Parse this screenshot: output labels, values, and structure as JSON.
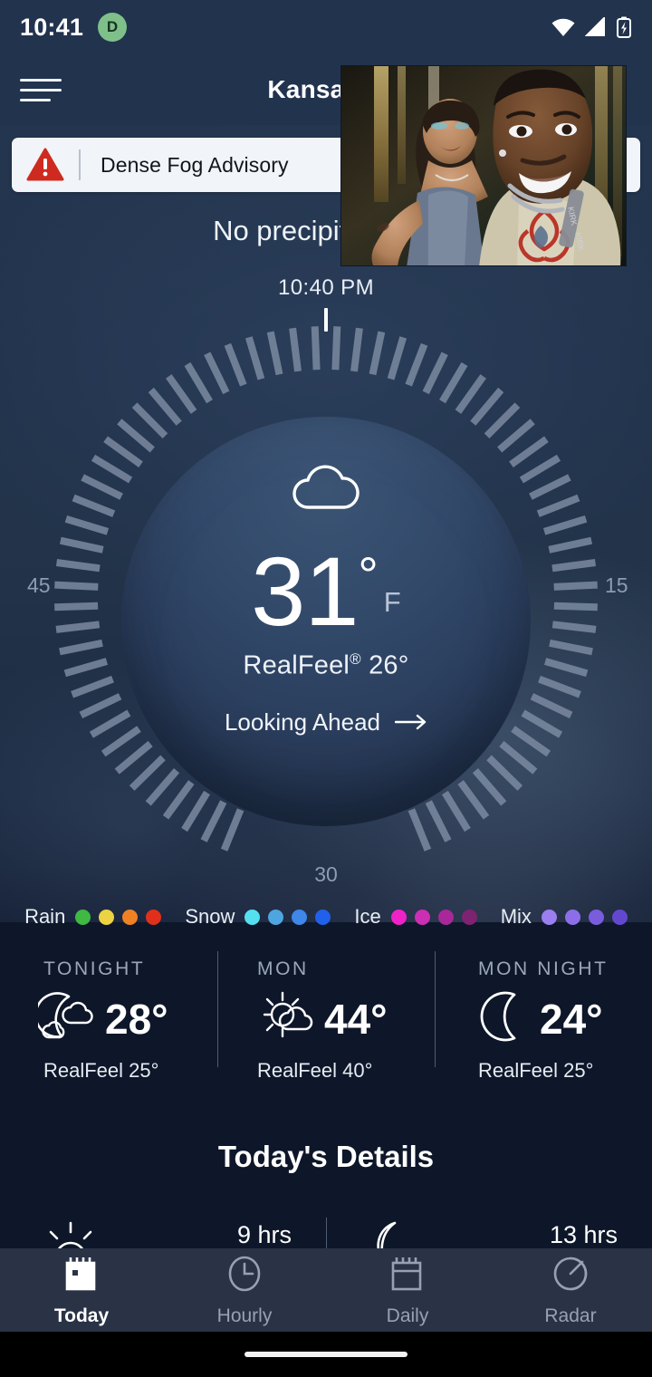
{
  "status_bar": {
    "time": "10:41",
    "badge_letter": "D",
    "icons": [
      "wifi-icon",
      "cellular-signal-icon",
      "battery-charging-icon"
    ]
  },
  "app_bar": {
    "menu_icon": "hamburger-menu-icon",
    "title": "Kansas C"
  },
  "alert": {
    "icon": "warning-triangle-icon",
    "text": "Dense Fog Advisory"
  },
  "precipitation_summary": "No precipitation fo",
  "dial": {
    "time_label": "10:40 PM",
    "label_left": "45",
    "label_right": "15",
    "label_bottom": "30",
    "weather_icon": "cloud-icon",
    "temperature": "31",
    "degree": "°",
    "unit": "F",
    "realfeel_prefix": "RealFeel",
    "realfeel_reg": "®",
    "realfeel_value": "26°",
    "looking_ahead_label": "Looking Ahead",
    "looking_ahead_icon": "arrow-right-icon"
  },
  "precip_legend": [
    {
      "label": "Rain",
      "colors": [
        "#3fb844",
        "#ecd341",
        "#ef8125",
        "#e0301c"
      ]
    },
    {
      "label": "Snow",
      "colors": [
        "#55e0f0",
        "#4fa5e0",
        "#3f87e8",
        "#2060ea"
      ]
    },
    {
      "label": "Ice",
      "colors": [
        "#ef22c8",
        "#cc2eb4",
        "#a8289a",
        "#7d2372"
      ]
    },
    {
      "label": "Mix",
      "colors": [
        "#9b7ff0",
        "#8c6fe8",
        "#7a5ddd",
        "#6348cf"
      ]
    }
  ],
  "forecast": [
    {
      "title": "TONIGHT",
      "icon": "moon-cloud-icon",
      "temp": "28°",
      "realfeel": "RealFeel 25°"
    },
    {
      "title": "MON",
      "icon": "sun-cloud-icon",
      "temp": "44°",
      "realfeel": "RealFeel 40°"
    },
    {
      "title": "MON NIGHT",
      "icon": "moon-icon",
      "temp": "24°",
      "realfeel": "RealFeel 25°"
    }
  ],
  "details": {
    "title": "Today's Details",
    "items": [
      {
        "icon": "sunrise-icon",
        "value": "9 hrs"
      },
      {
        "icon": "moon-phase-icon",
        "value": "13 hrs"
      }
    ]
  },
  "bottom_nav": [
    {
      "label": "Today",
      "icon": "calendar-today-icon",
      "active": true
    },
    {
      "label": "Hourly",
      "icon": "clock-icon",
      "active": false
    },
    {
      "label": "Daily",
      "icon": "calendar-icon",
      "active": false
    },
    {
      "label": "Radar",
      "icon": "radar-icon",
      "active": false
    }
  ],
  "pip_video": {
    "name": "picture-in-picture-video"
  },
  "colors": {
    "app_bar": "#22334e",
    "page_bg": "#0e1729",
    "alert_bg": "#f1f4f8",
    "alert_icon": "#cf2a1f",
    "nav_bg": "#2a3346",
    "accent_text": "#ffffff"
  }
}
